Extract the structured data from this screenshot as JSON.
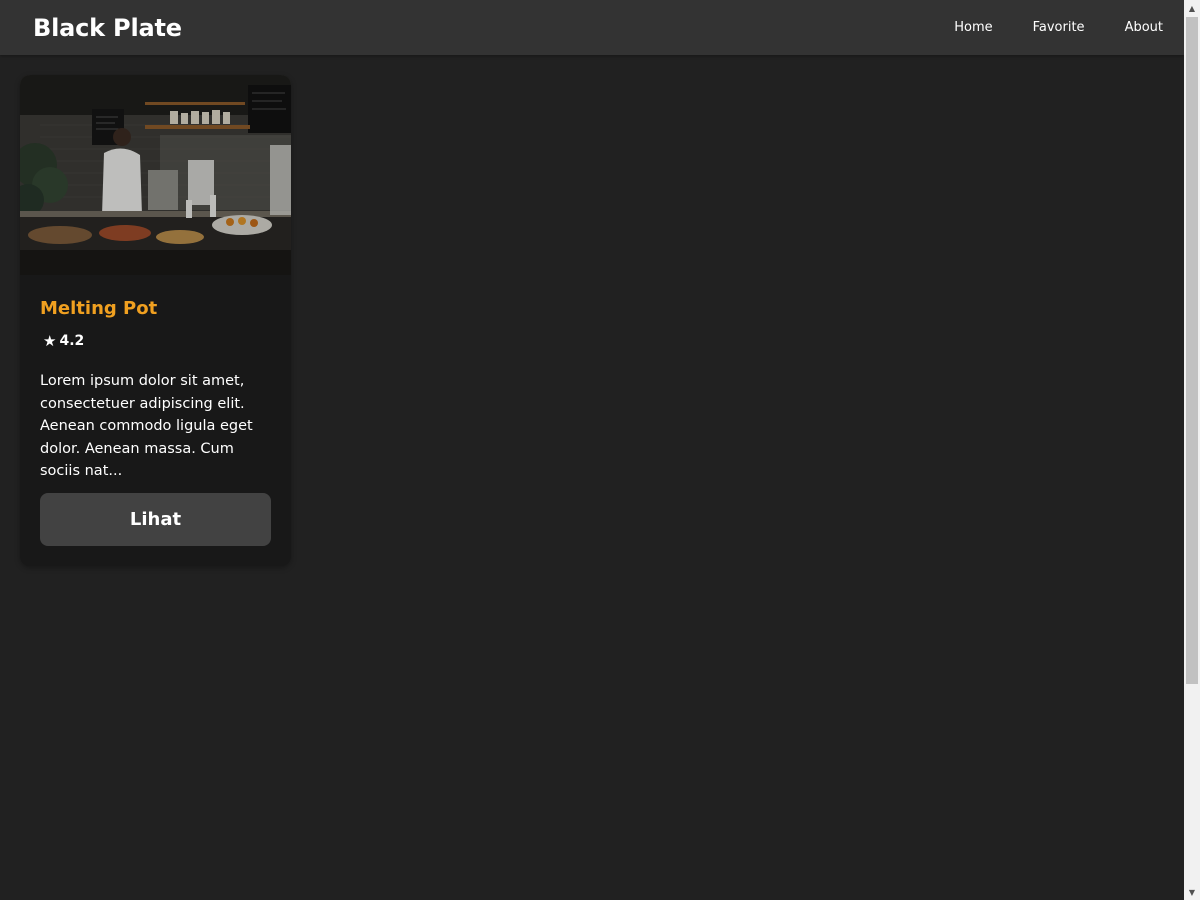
{
  "app": {
    "brand": "Black Plate"
  },
  "nav": {
    "links": [
      "Home",
      "Favorite",
      "About"
    ]
  },
  "restaurants": [
    {
      "name": "Melting Pot",
      "rating": "4.2",
      "star_icon": "star-icon",
      "description": "Lorem ipsum dolor sit amet, consectetuer adipiscing elit. Aenean commodo ligula eget dolor. Aenean massa. Cum sociis nat...",
      "button_label": "Lihat"
    }
  ],
  "colors": {
    "background": "#212121",
    "navbar": "#333333",
    "card": "#181818",
    "accent": "#f0a020",
    "button": "#424242"
  }
}
